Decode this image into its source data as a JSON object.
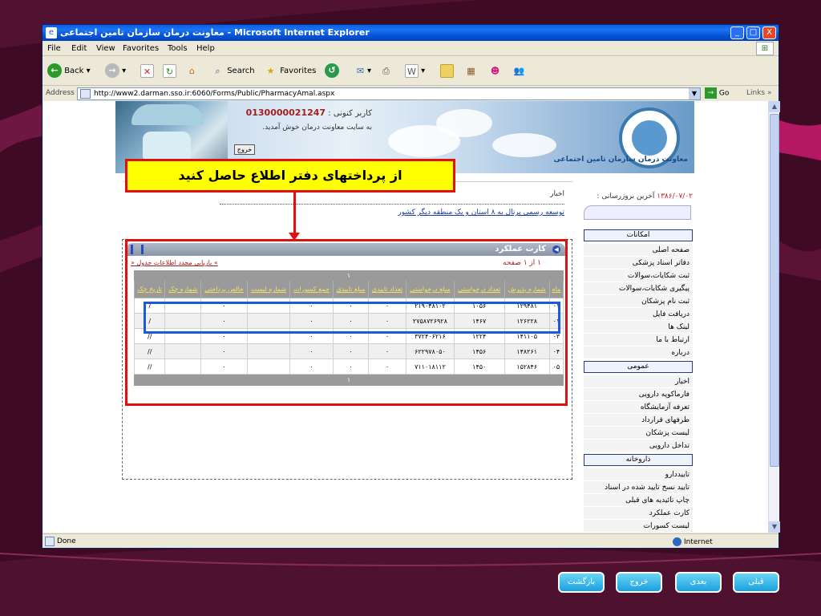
{
  "window": {
    "title": "معاونت درمان سازمان تامین اجتماعی - Microsoft Internet Explorer",
    "minimize": "_",
    "maximize": "□",
    "close": "X"
  },
  "menu": [
    "File",
    "Edit",
    "View",
    "Favorites",
    "Tools",
    "Help"
  ],
  "toolbar": {
    "back": "Back",
    "search": "Search",
    "favorites": "Favorites"
  },
  "address": {
    "label": "Address",
    "url": "http://www2.darman.sso.ir:6060/Forms/Public/PharmacyAmal.aspx",
    "go": "Go",
    "links": "Links"
  },
  "header": {
    "user_label": "کاربر کنونی :",
    "user_id": "0130000021247",
    "welcome": "به سایت معاونت درمان خوش آمدید.",
    "exit": "خروج",
    "org_name": "معاونت درمان سازمان تامین اجتماعی"
  },
  "news": {
    "label": "اخبار",
    "link": "توسعه رسمی پرتال به ۸ استان و یک منطقه دیگر کشور",
    "last_update_label": "آخرین بروزرسانی :",
    "last_update": "۱۳۸۶/۰۷/۰۲"
  },
  "sidebar": {
    "facilities_head": "امکانات",
    "facilities": [
      "صفحه اصلی",
      "دفاتر اسناد پزشکی",
      "ثبت شکایات،سوالات",
      "پیگیری شکایات،سوالات",
      "ثبت نام پزشکان",
      "دریافت فایل",
      "لینک ها",
      "ارتباط با ما",
      "درباره"
    ],
    "public_head": "عمومی",
    "public": [
      "اخبار",
      "فارماکوپه دارویی",
      "تعرفه آزمایشگاه",
      "طرفهای قرارداد",
      "لیست پزشکان",
      "تداخل دارویی"
    ],
    "pharmacy_head": "داروخانه",
    "pharmacy": [
      "تاییددارو",
      "تایید نسخ تایید شده در اسناد",
      "چاپ تائیدیه های قبلی",
      "کارت عملکرد",
      "لیست کسورات"
    ]
  },
  "card": {
    "title": "کارت عملکرد",
    "pager": "۱  از  ۱  صفحه",
    "back_link": "» بازیابی مجدد اطلاعات جدول «",
    "page_number": "۱",
    "headers": [
      "ماه",
      "شماره پذیرش",
      "تعداد درخواستی",
      "مبلغ درخواستی",
      "تعداد تاییدی",
      "مبلغ تاییدی",
      "جمع کسورات",
      "شماره لیست",
      "خالص پرداختی",
      "شماره چک",
      "تاریخ چک"
    ],
    "rows": [
      [
        "۰۱",
        "۱۲۹۴۸۱",
        "۱۰۵۶",
        "۲۱۹۰۴۸۱۰۲",
        "۰",
        "۰",
        "۰",
        "",
        "۰",
        "",
        "/"
      ],
      [
        "۰۱",
        "۱۲۶۲۲۸",
        "۱۴۶۷",
        "۲۷۵۸۷۲۶۹۲۸",
        "۰",
        "۰",
        "۰",
        "",
        "۰",
        "",
        "/"
      ],
      [
        "۰۳",
        "۱۴۱۱۰۵",
        "۱۲۲۴",
        "۳۷۲۴۰۶۲۱۶",
        "۰",
        "۰",
        "۰",
        "",
        "۰",
        "",
        "//"
      ],
      [
        "۰۴",
        "۱۴۸۲۶۱",
        "۱۴۵۶",
        "۶۲۲۹۷۸۰۵۰",
        "۰",
        "۰",
        "۰",
        "",
        "۰",
        "",
        "//"
      ],
      [
        "۰۵",
        "۱۵۲۸۴۶",
        "۱۴۵۰",
        "۷۱۱۰۱۸۱۱۲",
        "۰",
        "۰",
        "۰",
        "",
        "۰",
        "",
        "//"
      ]
    ],
    "footer_page": "۱"
  },
  "callout": "از پرداختهای دفتر اطلاع حاصل کنید",
  "status": {
    "text": "Done",
    "zone": "Internet"
  },
  "nav_buttons": {
    "prev": "قبلی",
    "next": "بعدی",
    "exit": "خروج",
    "back": "بازگشت"
  }
}
